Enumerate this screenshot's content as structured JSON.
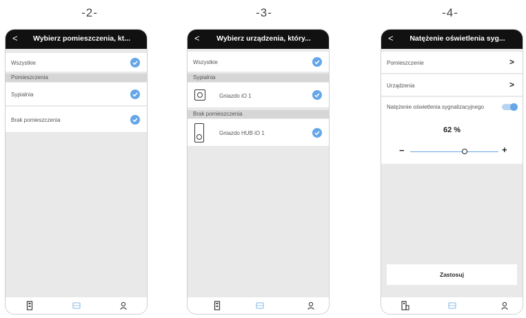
{
  "steps": [
    {
      "label": "-2-"
    },
    {
      "label": "-3-"
    },
    {
      "label": "-4-"
    }
  ],
  "screen2": {
    "title": "Wybierz pomieszczenia, kt...",
    "rows": {
      "all": "Wszystkie",
      "section_rooms": "Pomieszczenia",
      "bedroom": "Sypialnia",
      "no_room": "Brak pomieszczenia"
    }
  },
  "screen3": {
    "title": "Wybierz urządzenia, który...",
    "rows": {
      "all": "Wszystkie",
      "section_bedroom": "Sypialnia",
      "device1": "Gniazdo iO 1",
      "section_no_room": "Brak pomieszczenia",
      "device2": "Gniazdo HUB iO 1"
    }
  },
  "screen4": {
    "title": "Natężenie oświetlenia syg...",
    "rows": {
      "room": "Pomieszczenie",
      "devices": "Urządzenia",
      "signal_light": "Natężenie oświetlenia sygnalizacyjnego"
    },
    "brightness": {
      "value_text": "62 %",
      "value": 0.62,
      "minus": "−",
      "plus": "+"
    },
    "apply_label": "Zastosuj"
  },
  "icons": {
    "back": "back-chevron-icon",
    "check": "check-circle-icon",
    "tab1": "devices-tab-icon",
    "tab2": "scenes-tab-icon",
    "tab3": "profile-tab-icon"
  },
  "colors": {
    "header": "#111111",
    "accent": "#64a6e8",
    "background": "#e9e9e9"
  }
}
